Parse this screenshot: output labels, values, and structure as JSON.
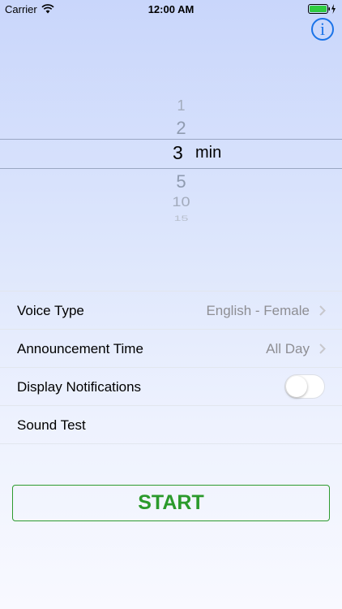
{
  "status_bar": {
    "carrier": "Carrier",
    "time": "12:00 AM",
    "wifi_icon": "wifi-icon",
    "battery_icon": "battery-charging-icon"
  },
  "header": {
    "info_label": "i",
    "info_icon": "info-icon",
    "accent_color": "#1a73e8"
  },
  "picker": {
    "items": [
      "1",
      "2",
      "3",
      "5",
      "10",
      "15"
    ],
    "selected": "3",
    "unit": "min"
  },
  "settings": {
    "voice_type": {
      "label": "Voice Type",
      "value": "English - Female"
    },
    "announcement_time": {
      "label": "Announcement Time",
      "value": "All Day"
    },
    "display_notifications": {
      "label": "Display Notifications",
      "enabled": false
    },
    "sound_test": {
      "label": "Sound Test"
    }
  },
  "start": {
    "label": "START",
    "color": "#2b9a2b"
  }
}
